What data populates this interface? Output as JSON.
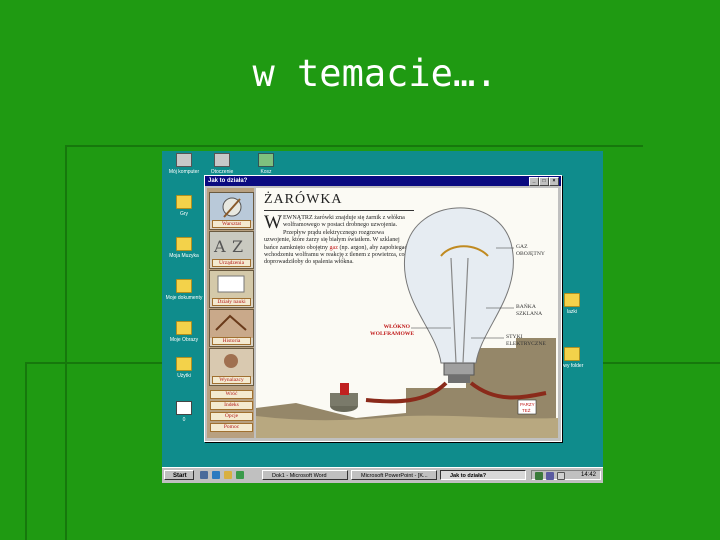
{
  "slide": {
    "title": "w temacie…."
  },
  "desktop": {
    "icons": [
      {
        "label": "Mój komputer"
      },
      {
        "label": "Otoczenie"
      },
      {
        "label": "Kosz"
      },
      {
        "label": "Gry"
      },
      {
        "label": "Moja Muzyka"
      },
      {
        "label": "Moje dokumenty"
      },
      {
        "label": "Moje Obrazy"
      },
      {
        "label": "Użytki"
      },
      {
        "label": "0"
      }
    ],
    "right_icons": [
      {
        "label": "lazki"
      },
      {
        "label": "owy folder"
      }
    ]
  },
  "window": {
    "title": "Jak to działa?",
    "controls": {
      "min": "_",
      "max": "□",
      "close": "×"
    },
    "nav": [
      {
        "label": "Warsztat"
      },
      {
        "label": "Urządzenia"
      },
      {
        "label": "Działy nauki"
      },
      {
        "label": "Historia"
      },
      {
        "label": "Wynalazcy"
      }
    ],
    "nav_buttons": [
      {
        "label": "Wróć"
      },
      {
        "label": "Indeks"
      },
      {
        "label": "Opcje"
      },
      {
        "label": "Pomoc"
      }
    ],
    "article": {
      "heading": "ŻARÓWKA",
      "dropcap": "W",
      "text_before": "EWNĄTRZ żarówki znajduje się żarnik z włókna wolframowego w postaci drobnego uzwojenia. Przepływ prądu elektrycznego rozgrzewa uzwojenie, które żarzy się białym światłem. W szklanej bańce zamknięto obojętny ",
      "highlight": "gaz",
      "text_after": " (np. argon), aby zapobiegać wchodzeniu wolframu w reakcję z tlenem z powietrza, co doprowadziłoby do spalenia włókna.",
      "callouts": {
        "gas": [
          "GAZ",
          "OBOJĘTNY"
        ],
        "bulb": [
          "BAŃKA",
          "SZKLANA"
        ],
        "contacts": [
          "STYKI",
          "ELEKTRYCZNE"
        ],
        "filament": [
          "WŁÓKNO",
          "WOLFRAMOWE"
        ]
      },
      "sign": [
        "PARZY",
        "TEŻ"
      ]
    }
  },
  "taskbar": {
    "start": "Start",
    "tasks": [
      {
        "label": "Dok1 - Microsoft Word"
      },
      {
        "label": "Microsoft PowerPoint - [K..."
      },
      {
        "label": "Jak to działa?"
      }
    ],
    "clock": "14:42"
  }
}
